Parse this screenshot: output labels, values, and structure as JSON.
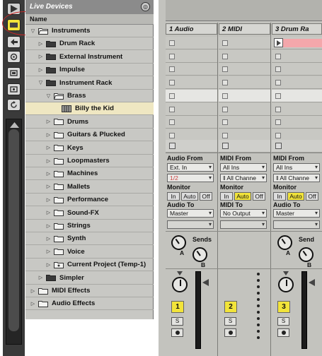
{
  "browser": {
    "title": "Live Devices",
    "column_header": "Name",
    "items": [
      {
        "label": "Instruments",
        "tri": "▽",
        "folder": "open",
        "indent": 0
      },
      {
        "label": "Drum Rack",
        "tri": "▷",
        "folder": "dark",
        "indent": 1
      },
      {
        "label": "External Instrument",
        "tri": "▷",
        "folder": "dark",
        "indent": 1
      },
      {
        "label": "Impulse",
        "tri": "▷",
        "folder": "dark",
        "indent": 1
      },
      {
        "label": "Instrument Rack",
        "tri": "▽",
        "folder": "dark",
        "indent": 1
      },
      {
        "label": "Brass",
        "tri": "▽",
        "folder": "open",
        "indent": 2
      },
      {
        "label": "Billy the Kid",
        "tri": "",
        "folder": "preset",
        "indent": 3,
        "selected": true
      },
      {
        "label": "Drums",
        "tri": "▷",
        "folder": "closed",
        "indent": 2
      },
      {
        "label": "Guitars & Plucked",
        "tri": "▷",
        "folder": "closed",
        "indent": 2
      },
      {
        "label": "Keys",
        "tri": "▷",
        "folder": "closed",
        "indent": 2
      },
      {
        "label": "Loopmasters",
        "tri": "▷",
        "folder": "closed",
        "indent": 2
      },
      {
        "label": "Machines",
        "tri": "▷",
        "folder": "closed",
        "indent": 2
      },
      {
        "label": "Mallets",
        "tri": "▷",
        "folder": "closed",
        "indent": 2
      },
      {
        "label": "Performance",
        "tri": "▷",
        "folder": "closed",
        "indent": 2
      },
      {
        "label": "Sound-FX",
        "tri": "▷",
        "folder": "closed",
        "indent": 2
      },
      {
        "label": "Strings",
        "tri": "▷",
        "folder": "closed",
        "indent": 2
      },
      {
        "label": "Synth",
        "tri": "▷",
        "folder": "closed",
        "indent": 2
      },
      {
        "label": "Voice",
        "tri": "▷",
        "folder": "closed",
        "indent": 2
      },
      {
        "label": "Current Project (Temp-1)",
        "tri": "▷",
        "folder": "project",
        "indent": 2
      },
      {
        "label": "Simpler",
        "tri": "▷",
        "folder": "dark",
        "indent": 1
      },
      {
        "label": "MIDI Effects",
        "tri": "▷",
        "folder": "closed",
        "indent": 0
      },
      {
        "label": "Audio Effects",
        "tri": "▷",
        "folder": "closed",
        "indent": 0
      }
    ]
  },
  "icons": {
    "strip": [
      "play-arrow-icon",
      "devices-folder-icon",
      "plugin-icon",
      "samples-icon",
      "clips-icon",
      "library-icon",
      "refresh-icon"
    ],
    "title_button": "dots-icon"
  },
  "colors": {
    "accent_yellow": "#f2e43a",
    "clip_pink": "#f4a7ab",
    "selected_row": "#efe7c2",
    "annotation_red": "#c82828"
  },
  "tracks": [
    {
      "name": "1 Audio",
      "io_from_label": "Audio From",
      "io_from": "Ext. In",
      "io_from_sub": "1/2",
      "monitor_label": "Monitor",
      "monitor": [
        "In",
        "Auto",
        "Off"
      ],
      "monitor_active": "none",
      "io_to_label": "Audio To",
      "io_to": "Master",
      "sends_label": "Sends",
      "number": "1",
      "solo": "S"
    },
    {
      "name": "2 MIDI",
      "io_from_label": "MIDI From",
      "io_from": "All Ins",
      "io_from_sub": "ǁ All Channe",
      "monitor_label": "Monitor",
      "monitor": [
        "In",
        "Auto",
        "Off"
      ],
      "monitor_active": "Auto",
      "io_to_label": "MIDI To",
      "io_to": "No Output",
      "number": "2",
      "solo": "S"
    },
    {
      "name": "3 Drum Ra",
      "io_from_label": "MIDI From",
      "io_from": "All Ins",
      "io_from_sub": "ǁ All Channe",
      "monitor_label": "Monitor",
      "monitor": [
        "In",
        "Auto",
        "Off"
      ],
      "monitor_active": "Auto",
      "io_to_label": "Audio To",
      "io_to": "Master",
      "sends_label": "Send",
      "number": "3",
      "solo": "S"
    }
  ],
  "knob_letters": [
    "A",
    "B"
  ]
}
